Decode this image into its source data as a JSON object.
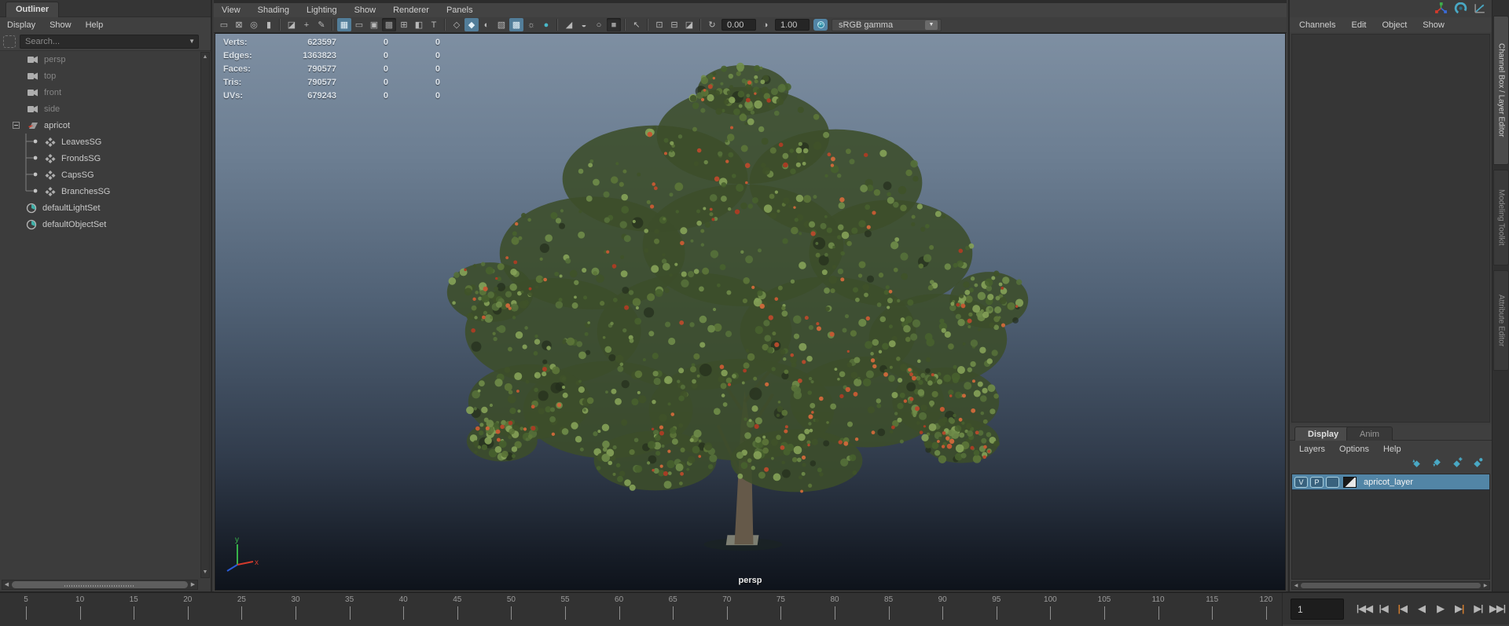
{
  "colors": {
    "accent": "#5285a6",
    "teal_icon": "#49a8c4",
    "key_orange": "#d07b2d",
    "selection_blue": "#5285a6"
  },
  "outliner": {
    "tab_label": "Outliner",
    "menus": [
      {
        "label": "Display"
      },
      {
        "label": "Show"
      },
      {
        "label": "Help"
      }
    ],
    "search_placeholder": "Search...",
    "items": [
      {
        "label": "persp",
        "icon": "camera-icon",
        "type": "camera",
        "dimmed": true
      },
      {
        "label": "top",
        "icon": "camera-icon",
        "type": "camera",
        "dimmed": true
      },
      {
        "label": "front",
        "icon": "camera-icon",
        "type": "camera",
        "dimmed": true
      },
      {
        "label": "side",
        "icon": "camera-icon",
        "type": "camera",
        "dimmed": true
      },
      {
        "label": "apricot",
        "icon": "transform-node-icon",
        "type": "root",
        "expanded": true
      },
      {
        "label": "LeavesSG",
        "icon": "shading-group-icon",
        "type": "sg"
      },
      {
        "label": "FrondsSG",
        "icon": "shading-group-icon",
        "type": "sg"
      },
      {
        "label": "CapsSG",
        "icon": "shading-group-icon",
        "type": "sg"
      },
      {
        "label": "BranchesSG",
        "icon": "shading-group-icon",
        "type": "sg",
        "last": true
      },
      {
        "label": "defaultLightSet",
        "icon": "object-set-icon",
        "type": "set"
      },
      {
        "label": "defaultObjectSet",
        "icon": "object-set-icon",
        "type": "set"
      }
    ]
  },
  "viewport": {
    "menus": [
      {
        "label": "View"
      },
      {
        "label": "Shading"
      },
      {
        "label": "Lighting"
      },
      {
        "label": "Show"
      },
      {
        "label": "Renderer"
      },
      {
        "label": "Panels"
      }
    ],
    "toolbar": [
      {
        "type": "btn",
        "name": "select-camera-icon",
        "glyph": "▭"
      },
      {
        "type": "btn",
        "name": "lock-camera-icon",
        "glyph": "⊠"
      },
      {
        "type": "btn",
        "name": "camera-attributes-icon",
        "glyph": "◎"
      },
      {
        "type": "btn",
        "name": "bookmark-view-icon",
        "glyph": "▮"
      },
      {
        "type": "sep"
      },
      {
        "type": "btn",
        "name": "image-plane-icon",
        "glyph": "◪"
      },
      {
        "type": "btn",
        "name": "pan-zoom-icon",
        "glyph": "+"
      },
      {
        "type": "btn",
        "name": "greasepencil-icon",
        "glyph": "✎"
      },
      {
        "type": "sep"
      },
      {
        "type": "btn",
        "name": "grid-icon",
        "glyph": "▦",
        "state": "active"
      },
      {
        "type": "btn",
        "name": "film-gate-icon",
        "glyph": "▭"
      },
      {
        "type": "btn",
        "name": "resolution-gate-icon",
        "glyph": "▣"
      },
      {
        "type": "btn",
        "name": "gate-mask-icon",
        "glyph": "▩",
        "state": "pressed"
      },
      {
        "type": "btn",
        "name": "field-chart-icon",
        "glyph": "⊞"
      },
      {
        "type": "btn",
        "name": "safe-action-icon",
        "glyph": "◧"
      },
      {
        "type": "btn",
        "name": "hud-icon",
        "glyph": "T"
      },
      {
        "type": "sep"
      },
      {
        "type": "btn",
        "name": "wireframe-icon",
        "glyph": "◇"
      },
      {
        "type": "btn",
        "name": "smooth-shade-icon",
        "glyph": "◆",
        "state": "active"
      },
      {
        "type": "btn",
        "name": "default-material-icon",
        "glyph": "◐"
      },
      {
        "type": "btn",
        "name": "textured-cube-icon",
        "glyph": "▧"
      },
      {
        "type": "btn",
        "name": "textured-icon",
        "glyph": "▩",
        "state": "active"
      },
      {
        "type": "btn",
        "name": "all-lights-icon",
        "glyph": "☼"
      },
      {
        "type": "btn",
        "name": "flat-lighting-icon",
        "glyph": "●",
        "state": "teal"
      },
      {
        "type": "sep"
      },
      {
        "type": "btn",
        "name": "shadows-icon",
        "glyph": "◢"
      },
      {
        "type": "btn",
        "name": "occlusion-icon",
        "glyph": "◒"
      },
      {
        "type": "btn",
        "name": "motion-blur-icon",
        "glyph": "○"
      },
      {
        "type": "btn",
        "name": "multisample-icon",
        "glyph": "■",
        "state": "pressed"
      },
      {
        "type": "sep"
      },
      {
        "type": "btn",
        "name": "isolate-select-icon",
        "glyph": "↖"
      },
      {
        "type": "sep"
      },
      {
        "type": "btn",
        "name": "snapshot-icon",
        "glyph": "⊡"
      },
      {
        "type": "btn",
        "name": "scene-render-view-icon",
        "glyph": "⊟"
      },
      {
        "type": "btn",
        "name": "render-image-icon",
        "glyph": "◪"
      },
      {
        "type": "sep"
      },
      {
        "type": "btn",
        "name": "exposure-icon",
        "glyph": "↻"
      },
      {
        "type": "field",
        "name": "exposure-field",
        "bind": "exposure_value"
      },
      {
        "type": "btn",
        "name": "contrast-icon",
        "glyph": "◑"
      },
      {
        "type": "field",
        "name": "gamma-field",
        "bind": "gamma_value"
      },
      {
        "type": "toggle",
        "name": "color-management-toggle"
      },
      {
        "type": "dropdown",
        "name": "view-transform-dropdown",
        "bind": "view_transform"
      }
    ],
    "exposure_value": "0.00",
    "gamma_value": "1.00",
    "view_transform": "sRGB gamma",
    "hud_rows": [
      {
        "label": "Verts:",
        "v1": "623597",
        "v2": "0",
        "v3": "0"
      },
      {
        "label": "Edges:",
        "v1": "1363823",
        "v2": "0",
        "v3": "0"
      },
      {
        "label": "Faces:",
        "v1": "790577",
        "v2": "0",
        "v3": "0"
      },
      {
        "label": "Tris:",
        "v1": "790577",
        "v2": "0",
        "v3": "0"
      },
      {
        "label": "UVs:",
        "v1": "679243",
        "v2": "0",
        "v3": "0"
      }
    ],
    "camera_label": "persp",
    "axis_labels": {
      "x": "x",
      "y": "y"
    }
  },
  "channel_box": {
    "menus": [
      {
        "label": "Channels"
      },
      {
        "label": "Edit"
      },
      {
        "label": "Object"
      },
      {
        "label": "Show"
      }
    ],
    "corner_icons": [
      "manipulator-icon",
      "speed-gauge-icon",
      "graph-editor-icon"
    ]
  },
  "side_tabs": [
    {
      "label": "Channel Box / Layer Editor",
      "active": true
    },
    {
      "label": "Modeling Toolkit",
      "active": false
    },
    {
      "label": "Attribute Editor",
      "active": false
    }
  ],
  "layer_editor": {
    "tabs": [
      {
        "label": "Display",
        "active": true
      },
      {
        "label": "Anim",
        "active": false
      }
    ],
    "menus": [
      {
        "label": "Layers"
      },
      {
        "label": "Options"
      },
      {
        "label": "Help"
      }
    ],
    "toolbar_icons": [
      "move-layer-up-icon",
      "move-layer-down-icon",
      "new-empty-layer-icon",
      "new-layer-from-selected-icon"
    ],
    "layers": [
      {
        "visibility": "V",
        "playback": "P",
        "name": "apricot_layer",
        "selected": true
      }
    ]
  },
  "timeline": {
    "ticks": [
      "5",
      "10",
      "15",
      "20",
      "25",
      "30",
      "35",
      "40",
      "45",
      "50",
      "55",
      "60",
      "65",
      "70",
      "75",
      "80",
      "85",
      "90",
      "95",
      "100",
      "105",
      "110",
      "115",
      "120"
    ],
    "tick_start_x": 33,
    "tick_spacing": 68.6,
    "current_frame": "1",
    "controls": [
      {
        "name": "go-to-playback-start-button",
        "parts": [
          "bar",
          "◀",
          "◀"
        ]
      },
      {
        "name": "step-back-one-frame-button",
        "parts": [
          "bar",
          "◀"
        ]
      },
      {
        "name": "step-back-one-key-button",
        "parts": [
          "kbar",
          "◀"
        ]
      },
      {
        "name": "play-backwards-button",
        "parts": [
          "◀"
        ]
      },
      {
        "name": "play-forwards-button",
        "parts": [
          "▶"
        ]
      },
      {
        "name": "step-forward-one-key-button",
        "parts": [
          "▶",
          "kbar"
        ]
      },
      {
        "name": "step-forward-one-frame-button",
        "parts": [
          "▶",
          "bar"
        ]
      },
      {
        "name": "go-to-playback-end-button",
        "parts": [
          "▶",
          "▶",
          "bar"
        ]
      }
    ]
  }
}
